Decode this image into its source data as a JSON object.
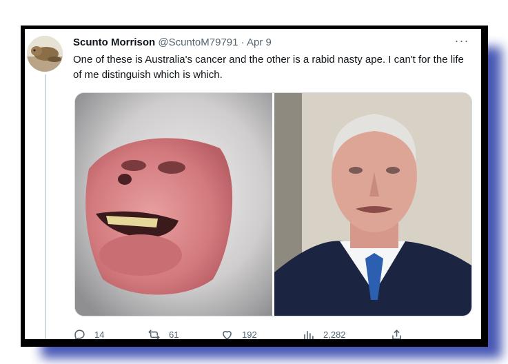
{
  "tweet": {
    "display_name": "Scunto Morrison",
    "handle": "@ScuntoM79791",
    "separator": "·",
    "date": "Apr 9",
    "text": "One of these is Australia's cancer and the other is a rabid nasty ape. I can't for the life of me distinguish which is which.",
    "more_label": "···"
  },
  "media": {
    "left_image": "baboon face photo",
    "right_image": "elderly man in suit photo"
  },
  "actions": {
    "replies": "14",
    "retweets": "61",
    "likes": "192",
    "views": "2,282"
  },
  "icons": [
    "reply-icon",
    "retweet-icon",
    "like-icon",
    "views-icon",
    "share-icon",
    "more-icon"
  ],
  "colors": {
    "frame": "#000000",
    "shadow": "#3f4fb0",
    "text": "#0f1419",
    "muted": "#536471",
    "border": "#cfd9de"
  }
}
